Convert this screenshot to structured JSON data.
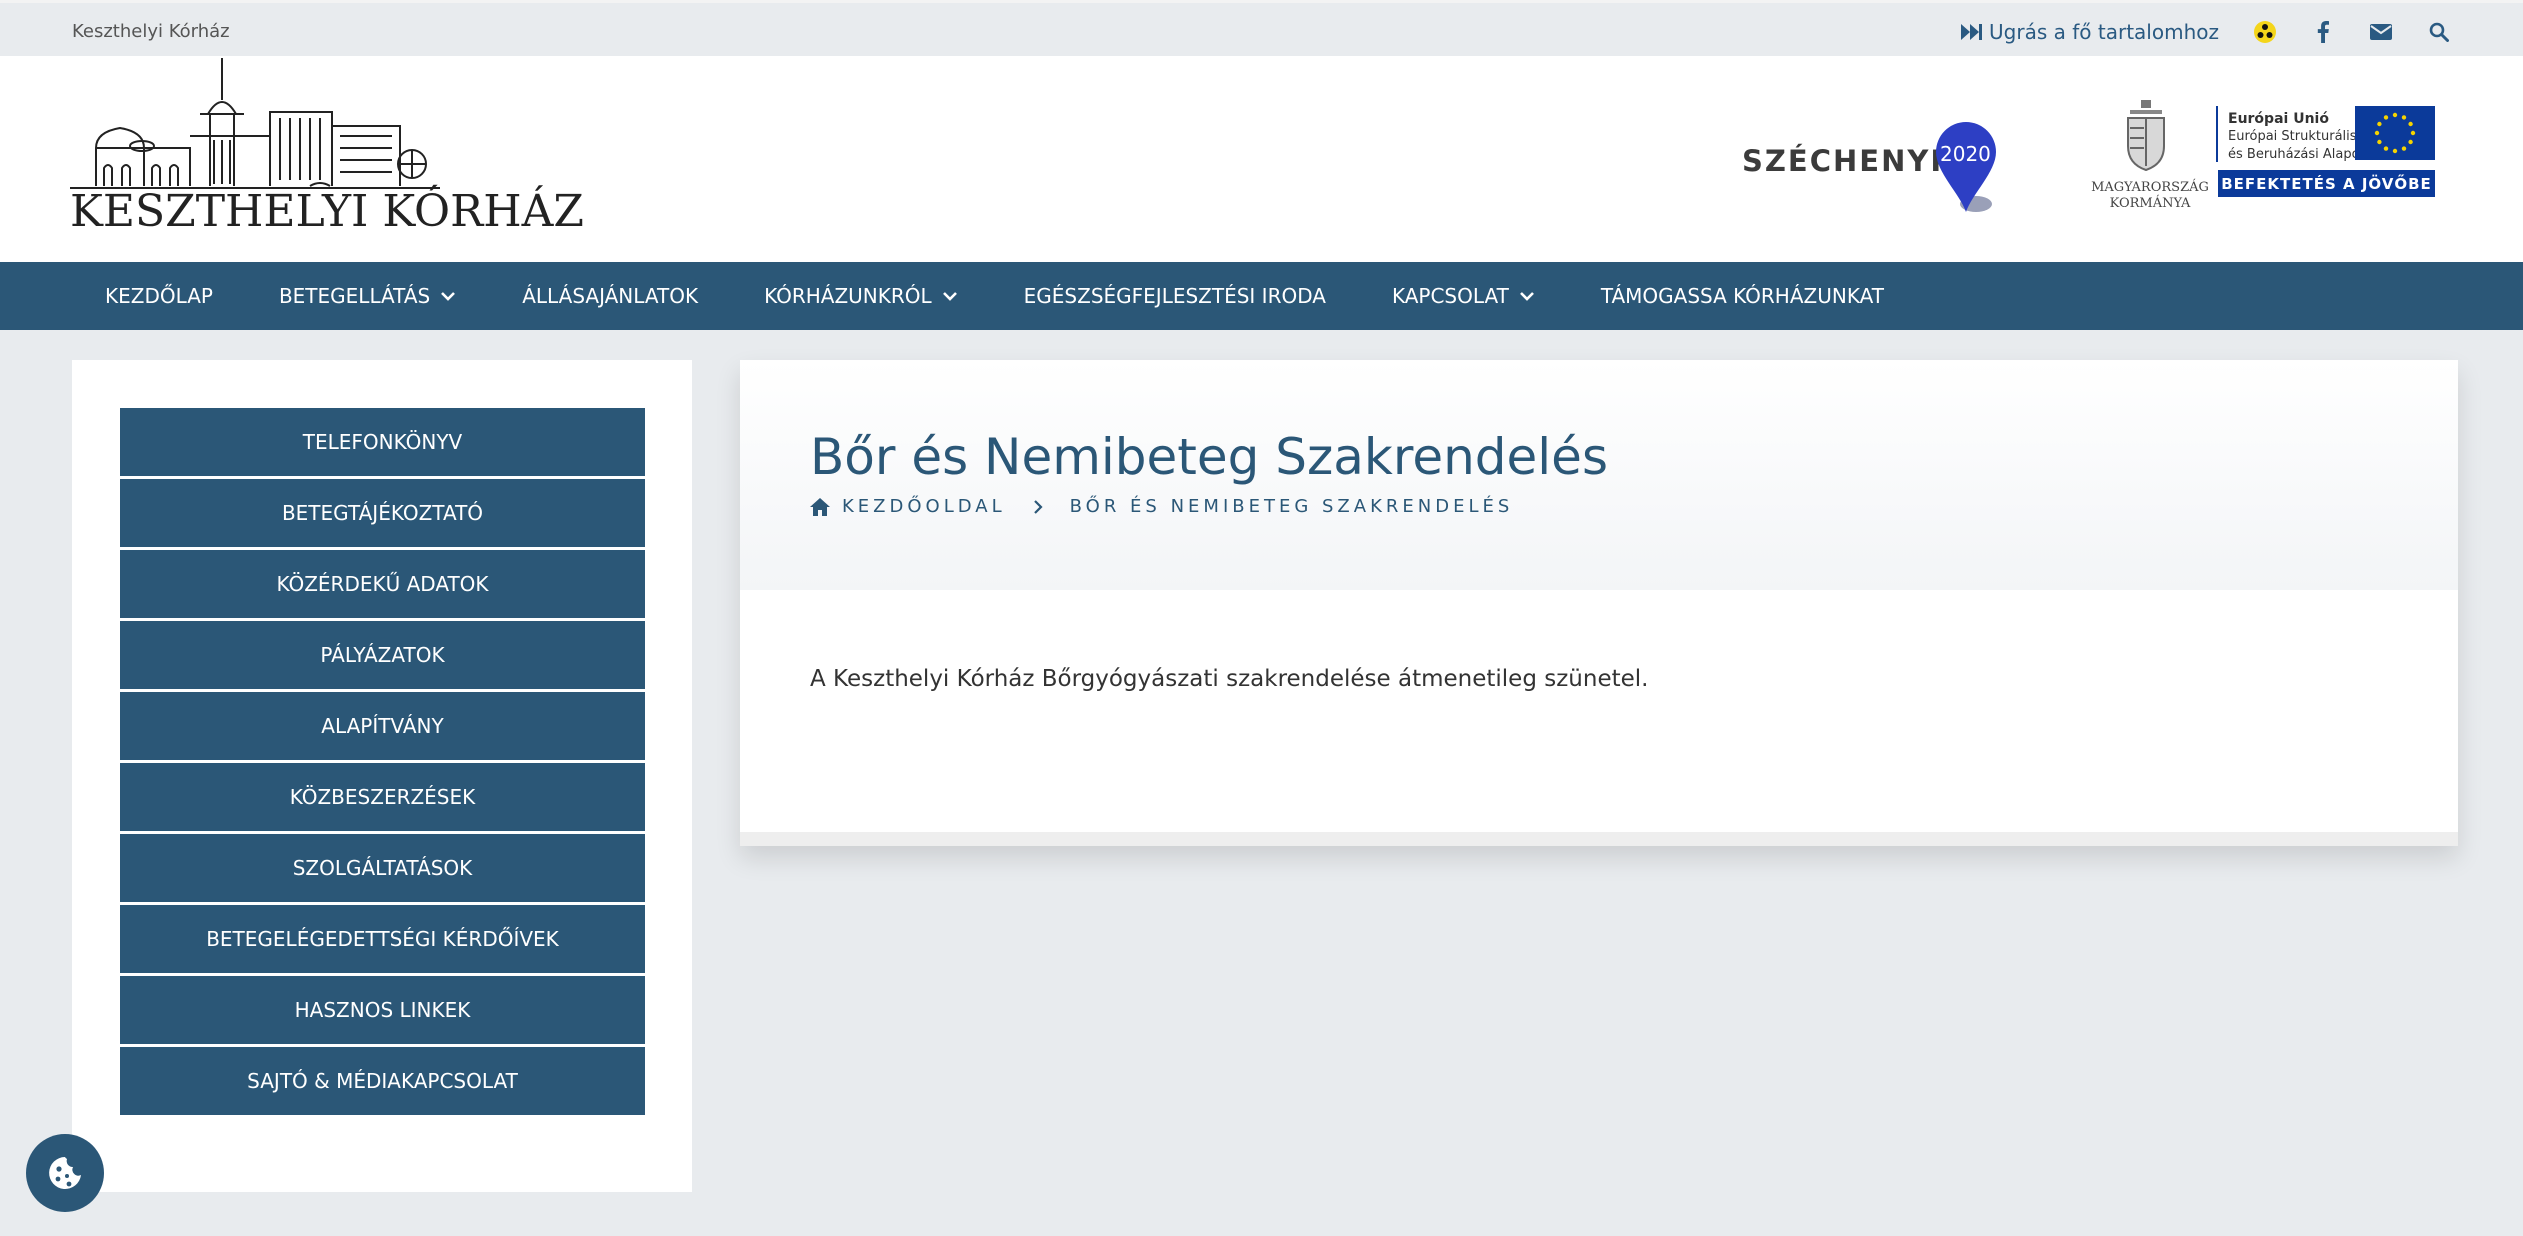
{
  "topbar": {
    "site_name": "Keszthelyi Kórház",
    "skip_link": "Ugrás a fő tartalomhoz",
    "icons": [
      "fast-forward-icon",
      "accessibility-icon",
      "facebook-icon",
      "envelope-icon",
      "search-icon"
    ]
  },
  "header": {
    "logo_text": "KESZTHELYI KÓRHÁZ",
    "szechenyi_text": "SZÉCHENYI",
    "szechenyi_year": "2020",
    "gov_line1": "MAGYARORSZÁG",
    "gov_line2": "KORMÁNYA",
    "eu_line1": "Európai Unió",
    "eu_line2": "Európai Strukturális",
    "eu_line3": "és Beruházási Alapok",
    "eu_band": "BEFEKTETÉS A JÖVŐBE"
  },
  "nav": {
    "items": [
      {
        "label": "KEZDŐLAP",
        "dropdown": false
      },
      {
        "label": "BETEGELLÁTÁS",
        "dropdown": true
      },
      {
        "label": "ÁLLÁSAJÁNLATOK",
        "dropdown": false
      },
      {
        "label": "KÓRHÁZUNKRÓL",
        "dropdown": true
      },
      {
        "label": "EGÉSZSÉGFEJLESZTÉSI IRODA",
        "dropdown": false
      },
      {
        "label": "KAPCSOLAT",
        "dropdown": true
      },
      {
        "label": "TÁMOGASSA KÓRHÁZUNKAT",
        "dropdown": false
      }
    ]
  },
  "sidebar": {
    "items": [
      {
        "label": "TELEFONKÖNYV"
      },
      {
        "label": "BETEGTÁJÉKOZTATÓ"
      },
      {
        "label": "KÖZÉRDEKŰ ADATOK"
      },
      {
        "label": "PÁLYÁZATOK"
      },
      {
        "label": "ALAPÍTVÁNY"
      },
      {
        "label": "KÖZBESZERZÉSEK"
      },
      {
        "label": "SZOLGÁLTATÁSOK"
      },
      {
        "label": "BETEGELÉGEDETTSÉGI KÉRDŐÍVEK"
      },
      {
        "label": "HASZNOS LINKEK"
      },
      {
        "label": "SAJTÓ & MÉDIAKAPCSOLAT"
      }
    ]
  },
  "main": {
    "title": "Bőr és Nemibeteg Szakrendelés",
    "breadcrumb": {
      "home": "KEZDŐOLDAL",
      "current": "BŐR ÉS NEMIBETEG SZAKRENDELÉS"
    },
    "body": "A Keszthelyi Kórház Bőrgyógyászati szakrendelése átmenetileg szünetel."
  },
  "colors": {
    "primary": "#2b5777",
    "background": "#e8ebee",
    "eu_blue": "#0b3a9a",
    "szechenyi_blue": "#2d3fc4"
  }
}
